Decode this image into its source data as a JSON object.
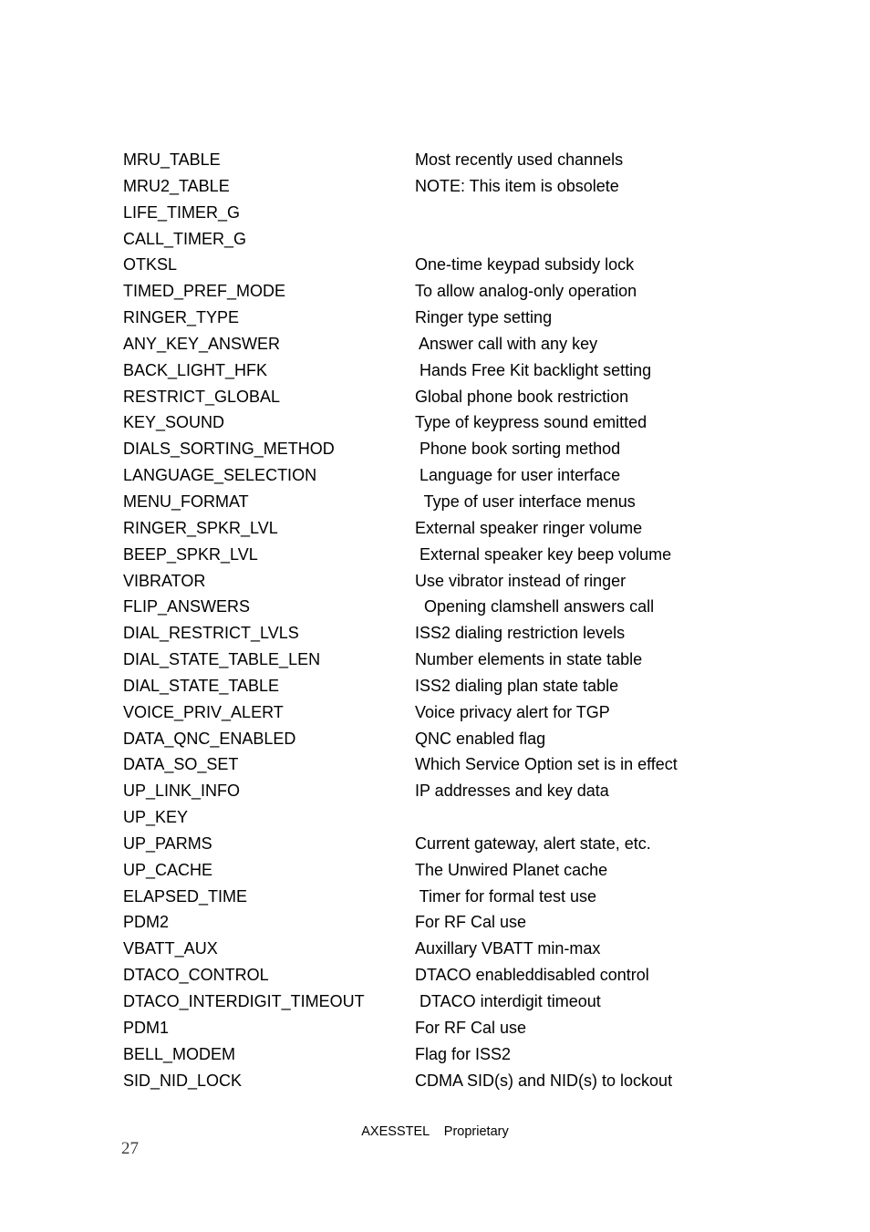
{
  "document": {
    "page_number": "27",
    "footer_text": "AXESSTEL    Proprietary"
  },
  "entries": [
    {
      "name": "MRU_TABLE",
      "desc": "Most recently used channels"
    },
    {
      "name": "MRU2_TABLE",
      "desc": "NOTE: This item is obsolete"
    },
    {
      "name": "LIFE_TIMER_G",
      "desc": ""
    },
    {
      "name": "CALL_TIMER_G",
      "desc": ""
    },
    {
      "name": "OTKSL",
      "desc": "One-time keypad subsidy lock"
    },
    {
      "name": "TIMED_PREF_MODE",
      "desc": "To allow analog-only operation"
    },
    {
      "name": "RINGER_TYPE",
      "desc": "Ringer type setting"
    },
    {
      "name": "ANY_KEY_ANSWER",
      "desc": " Answer call with any key"
    },
    {
      "name": "BACK_LIGHT_HFK",
      "desc": " Hands Free Kit backlight setting"
    },
    {
      "name": "RESTRICT_GLOBAL",
      "desc": "Global phone book restriction"
    },
    {
      "name": "KEY_SOUND",
      "desc": "Type of keypress sound emitted"
    },
    {
      "name": "DIALS_SORTING_METHOD",
      "desc": " Phone book sorting method"
    },
    {
      "name": "LANGUAGE_SELECTION",
      "desc": " Language for user interface"
    },
    {
      "name": "MENU_FORMAT",
      "desc": "  Type of user interface menus"
    },
    {
      "name": "RINGER_SPKR_LVL",
      "desc": "External speaker ringer volume"
    },
    {
      "name": "BEEP_SPKR_LVL",
      "desc": " External speaker key beep volume"
    },
    {
      "name": "VIBRATOR",
      "desc": "Use vibrator instead of ringer"
    },
    {
      "name": "FLIP_ANSWERS",
      "desc": "  Opening clamshell answers call"
    },
    {
      "name": "DIAL_RESTRICT_LVLS",
      "desc": "ISS2 dialing restriction levels"
    },
    {
      "name": "DIAL_STATE_TABLE_LEN",
      "desc": "Number elements in state table"
    },
    {
      "name": "DIAL_STATE_TABLE",
      "desc": "ISS2 dialing plan state table"
    },
    {
      "name": "VOICE_PRIV_ALERT",
      "desc": "Voice privacy alert for TGP"
    },
    {
      "name": "DATA_QNC_ENABLED",
      "desc": "QNC enabled flag"
    },
    {
      "name": "DATA_SO_SET",
      "desc": "Which Service Option set is in effect"
    },
    {
      "name": "UP_LINK_INFO",
      "desc": "IP addresses and key data"
    },
    {
      "name": "UP_KEY",
      "desc": ""
    },
    {
      "name": "UP_PARMS",
      "desc": "Current gateway, alert state, etc."
    },
    {
      "name": "UP_CACHE",
      "desc": "The Unwired Planet cache"
    },
    {
      "name": "ELAPSED_TIME",
      "desc": " Timer for formal test use"
    },
    {
      "name": "PDM2",
      "desc": "For RF Cal use"
    },
    {
      "name": "VBATT_AUX",
      "desc": "Auxillary VBATT min-max"
    },
    {
      "name": "DTACO_CONTROL",
      "desc": "DTACO enableddisabled control"
    },
    {
      "name": "DTACO_INTERDIGIT_TIMEOUT",
      "desc": " DTACO interdigit timeout"
    },
    {
      "name": "PDM1",
      "desc": "For RF Cal use"
    },
    {
      "name": "BELL_MODEM",
      "desc": "Flag for ISS2"
    },
    {
      "name": "SID_NID_LOCK",
      "desc": "CDMA SID(s) and NID(s) to lockout"
    }
  ]
}
